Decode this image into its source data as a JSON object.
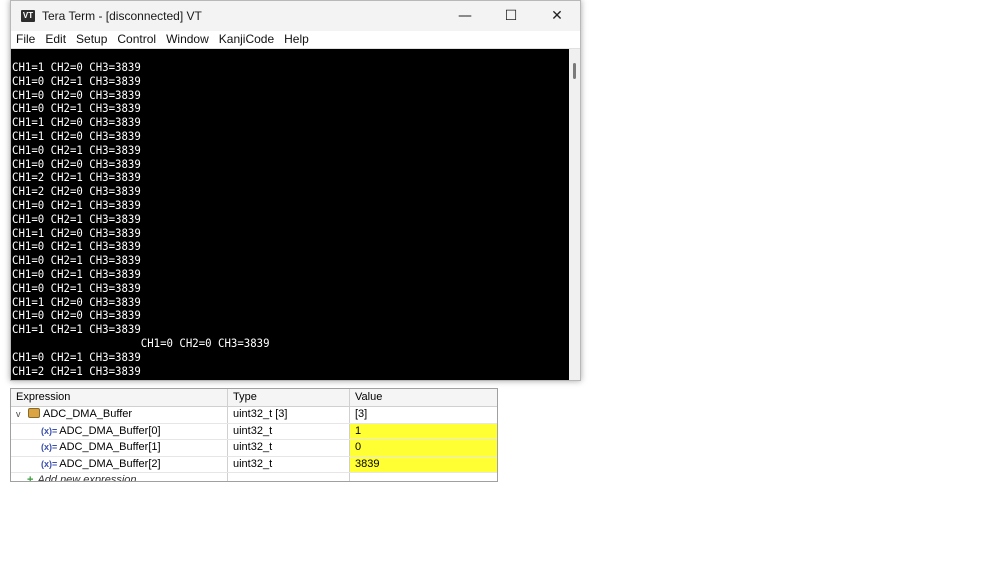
{
  "window": {
    "title": "Tera Term - [disconnected] VT",
    "icon_label": "VT",
    "controls": {
      "minimize": "—",
      "maximize": "☐",
      "close": "✕"
    }
  },
  "menu": [
    "File",
    "Edit",
    "Setup",
    "Control",
    "Window",
    "KanjiCode",
    "Help"
  ],
  "terminal": {
    "lines": [
      "CH1=1 CH2=0 CH3=3839",
      "CH1=0 CH2=1 CH3=3839",
      "CH1=0 CH2=0 CH3=3839",
      "CH1=0 CH2=1 CH3=3839",
      "CH1=1 CH2=0 CH3=3839",
      "CH1=1 CH2=0 CH3=3839",
      "CH1=0 CH2=1 CH3=3839",
      "CH1=0 CH2=0 CH3=3839",
      "CH1=2 CH2=1 CH3=3839",
      "CH1=2 CH2=0 CH3=3839",
      "CH1=0 CH2=1 CH3=3839",
      "CH1=0 CH2=1 CH3=3839",
      "CH1=1 CH2=0 CH3=3839",
      "CH1=0 CH2=1 CH3=3839",
      "CH1=0 CH2=1 CH3=3839",
      "CH1=0 CH2=1 CH3=3839",
      "CH1=0 CH2=1 CH3=3839",
      "CH1=1 CH2=0 CH3=3839",
      "CH1=0 CH2=0 CH3=3839",
      "CH1=1 CH2=1 CH3=3839",
      "                    CH1=0 CH2=0 CH3=3839",
      "CH1=0 CH2=1 CH3=3839",
      "CH1=2 CH2=1 CH3=3839"
    ]
  },
  "expressions": {
    "headers": {
      "expression": "Expression",
      "type": "Type",
      "value": "Value"
    },
    "root": {
      "expand": "v",
      "name": "ADC_DMA_Buffer",
      "type": "uint32_t [3]",
      "value": "[3]"
    },
    "children": [
      {
        "prefix": "(x)=",
        "name": "ADC_DMA_Buffer[0]",
        "type": "uint32_t",
        "value": "1"
      },
      {
        "prefix": "(x)=",
        "name": "ADC_DMA_Buffer[1]",
        "type": "uint32_t",
        "value": "0"
      },
      {
        "prefix": "(x)=",
        "name": "ADC_DMA_Buffer[2]",
        "type": "uint32_t",
        "value": "3839"
      }
    ],
    "add_new": {
      "icon": "+",
      "label": "Add new expression"
    },
    "highlight_color": "#ffff33"
  }
}
